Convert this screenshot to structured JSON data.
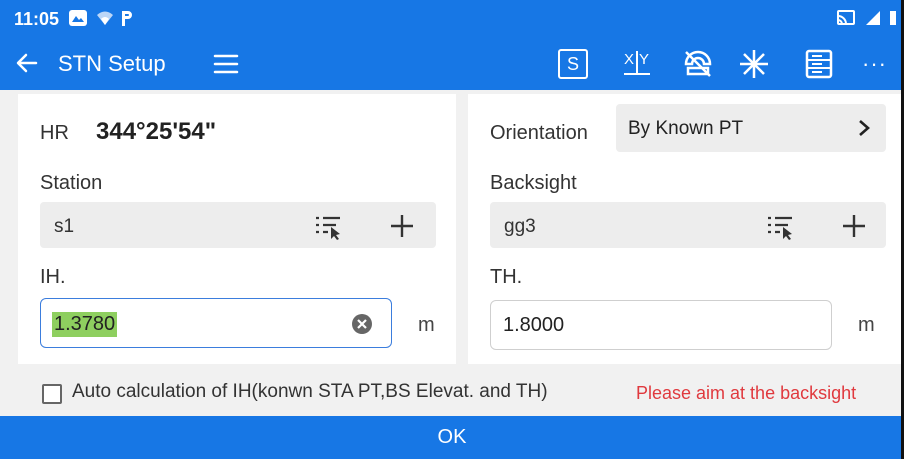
{
  "status_bar": {
    "time": "11:05"
  },
  "app_bar": {
    "title": "STN Setup",
    "s_button_label": "S",
    "more_label": "···"
  },
  "left_panel": {
    "hr_label": "HR",
    "hr_value": "344°25'54\"",
    "station_label": "Station",
    "station_value": "s1",
    "ih_label": "IH.",
    "ih_value": "1.3780",
    "ih_unit": "m"
  },
  "right_panel": {
    "orientation_label": "Orientation",
    "orientation_value": "By Known PT",
    "backsight_label": "Backsight",
    "backsight_value": "gg3",
    "th_label": "TH.",
    "th_value": "1.8000",
    "th_unit": "m"
  },
  "footer": {
    "auto_calc_label": "Auto calculation of IH(konwn STA PT,BS Elevat. and TH)",
    "auto_calc_checked": false,
    "warning": "Please aim at the backsight",
    "ok_label": "OK"
  },
  "colors": {
    "primary": "#1777e5",
    "warning": "#e0393e",
    "highlight": "#8ecf5f"
  }
}
